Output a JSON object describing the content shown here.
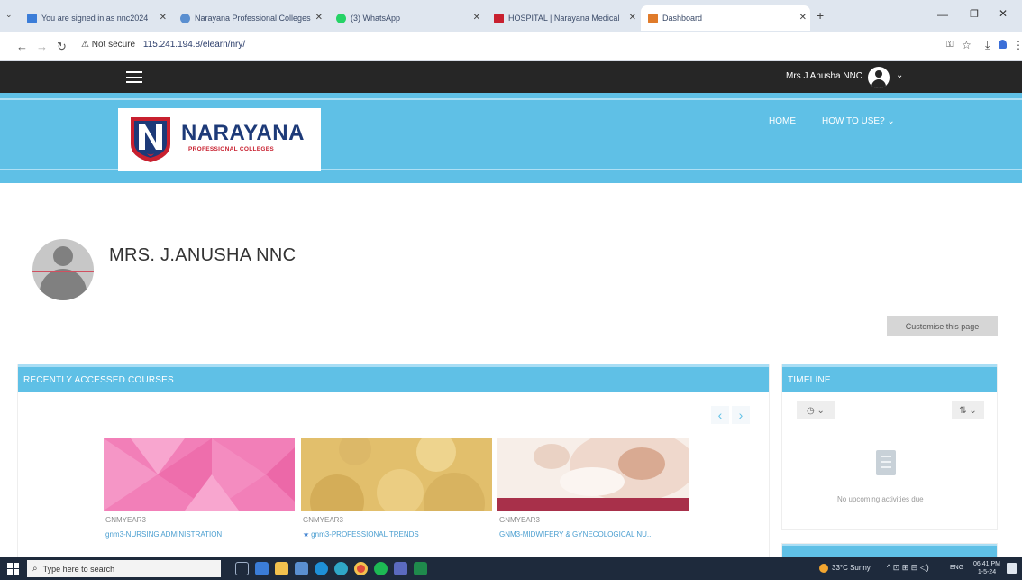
{
  "browser": {
    "tabs": [
      {
        "title": "You are signed in as nnc2024",
        "favicon_color": "#3b7dd8"
      },
      {
        "title": "Narayana Professional Colleges",
        "favicon_color": "#5a8fd0"
      },
      {
        "title": "(3) WhatsApp",
        "favicon_color": "#25d366"
      },
      {
        "title": "HOSPITAL | Narayana Medical",
        "favicon_color": "#c8202f"
      },
      {
        "title": "Dashboard",
        "favicon_color": "#e07b2a"
      }
    ],
    "new_tab": "+",
    "security": "⚠ Not secure",
    "url": "115.241.194.8/elearn/nry/"
  },
  "navbar": {
    "user_name": "Mrs J Anusha NNC"
  },
  "header": {
    "logo_name": "NARAYANA",
    "logo_subtitle": "PROFESSIONAL COLLEGES",
    "menu": [
      {
        "label": "HOME"
      },
      {
        "label": "HOW TO USE? ⌄"
      }
    ]
  },
  "profile": {
    "name": "MRS. J.ANUSHA NNC",
    "customise_label": "Customise this page"
  },
  "recent_courses": {
    "heading": "RECENTLY ACCESSED COURSES",
    "courses": [
      {
        "category": "GNMYEAR3",
        "name": "gnm3-NURSING ADMINISTRATION",
        "starred": false,
        "image": "pink-pattern"
      },
      {
        "category": "GNMYEAR3",
        "name": "gnm3-PROFESSIONAL TRENDS",
        "starred": true,
        "image": "gold-pattern"
      },
      {
        "category": "GNMYEAR3",
        "name": "GNM3-MIDWIFERY & GYNECOLOGICAL NU...",
        "starred": false,
        "image": "mother-baby-photo"
      }
    ]
  },
  "timeline": {
    "heading": "TIMELINE",
    "empty_text": "No upcoming activities due"
  },
  "taskbar": {
    "search_placeholder": "Type here to search",
    "weather": "33°C  Sunny",
    "tray_icons": "^ ⊡ ⊞ ⊟ ◁)",
    "language": "ENG",
    "time": "06:41 PM",
    "date": "1-5-24"
  }
}
